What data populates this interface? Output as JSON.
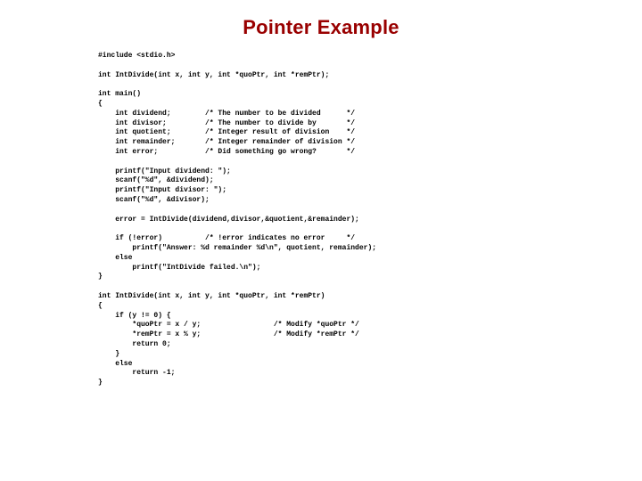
{
  "title": "Pointer Example",
  "code": "#include <stdio.h>\n\nint IntDivide(int x, int y, int *quoPtr, int *remPtr);\n\nint main()\n{\n    int dividend;        /* The number to be divided      */\n    int divisor;         /* The number to divide by       */\n    int quotient;        /* Integer result of division    */\n    int remainder;       /* Integer remainder of division */\n    int error;           /* Did something go wrong?       */\n\n    printf(\"Input dividend: \");\n    scanf(\"%d\", &dividend);\n    printf(\"Input divisor: \");\n    scanf(\"%d\", &divisor);\n\n    error = IntDivide(dividend,divisor,&quotient,&remainder);\n\n    if (!error)          /* !error indicates no error     */\n        printf(\"Answer: %d remainder %d\\n\", quotient, remainder);\n    else\n        printf(\"IntDivide failed.\\n\");\n}\n\nint IntDivide(int x, int y, int *quoPtr, int *remPtr)\n{\n    if (y != 0) {\n        *quoPtr = x / y;                 /* Modify *quoPtr */\n        *remPtr = x % y;                 /* Modify *remPtr */\n        return 0;\n    }\n    else\n        return -1;\n}"
}
